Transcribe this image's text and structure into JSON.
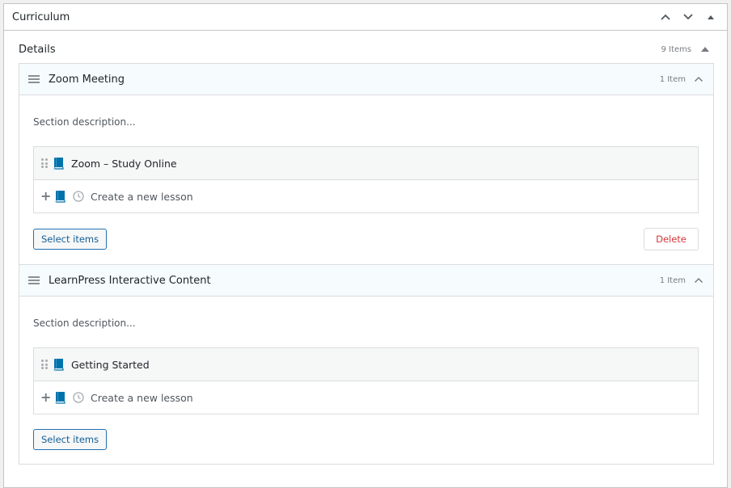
{
  "postbox": {
    "title": "Curriculum",
    "move_up_icon": "chevron-up-icon",
    "move_down_icon": "chevron-down-icon",
    "toggle_icon": "triangle-up-icon"
  },
  "details": {
    "title": "Details",
    "items_count": "9 Items"
  },
  "sections": [
    {
      "title": "Zoom Meeting",
      "count": "1 Item",
      "description_placeholder": "Section description...",
      "items": [
        {
          "title": "Zoom – Study Online",
          "icon": "book-icon"
        }
      ],
      "new_lesson_placeholder": "Create a new lesson",
      "select_items_label": "Select items",
      "delete_label": "Delete"
    },
    {
      "title": "LearnPress Interactive Content",
      "count": "1 Item",
      "description_placeholder": "Section description...",
      "items": [
        {
          "title": "Getting Started",
          "icon": "book-icon"
        }
      ],
      "new_lesson_placeholder": "Create a new lesson",
      "select_items_label": "Select items"
    }
  ],
  "colors": {
    "accent": "#2271b1",
    "book_icon": "#0073aa",
    "delete": "#d63638",
    "section_header_bg": "#f6fbfe"
  }
}
